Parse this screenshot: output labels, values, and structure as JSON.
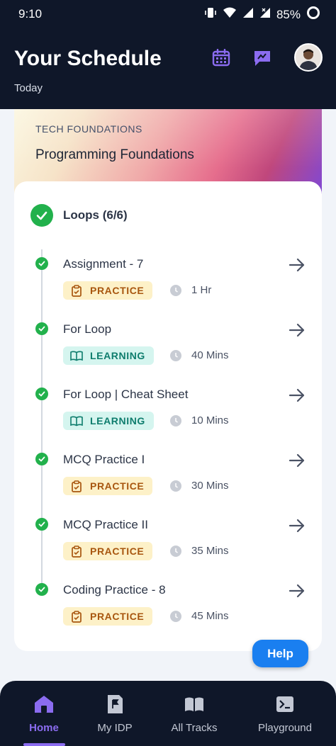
{
  "status_bar": {
    "time": "9:10",
    "battery": "85%"
  },
  "header": {
    "title": "Your Schedule",
    "subtitle": "Today"
  },
  "course": {
    "category": "TECH FOUNDATIONS",
    "name": "Programming Foundations"
  },
  "module": {
    "title": "Loops (6/6)"
  },
  "items": [
    {
      "name": "Assignment - 7",
      "tag": "PRACTICE",
      "duration": "1 Hr"
    },
    {
      "name": "For Loop",
      "tag": "LEARNING",
      "duration": "40 Mins"
    },
    {
      "name": "For Loop | Cheat Sheet",
      "tag": "LEARNING",
      "duration": "10 Mins"
    },
    {
      "name": "MCQ Practice I",
      "tag": "PRACTICE",
      "duration": "30 Mins"
    },
    {
      "name": "MCQ Practice II",
      "tag": "PRACTICE",
      "duration": "35 Mins"
    },
    {
      "name": "Coding Practice - 8",
      "tag": "PRACTICE",
      "duration": "45 Mins"
    }
  ],
  "help": {
    "label": "Help"
  },
  "nav": [
    {
      "label": "Home",
      "icon": "home-icon",
      "active": true
    },
    {
      "label": "My IDP",
      "icon": "flag-icon",
      "active": false
    },
    {
      "label": "All Tracks",
      "icon": "book-icon",
      "active": false
    },
    {
      "label": "Playground",
      "icon": "terminal-icon",
      "active": false
    }
  ],
  "colors": {
    "header_bg": "#0f1729",
    "accent": "#8b6cf0",
    "success": "#22b14c",
    "help": "#1a7ff0"
  }
}
